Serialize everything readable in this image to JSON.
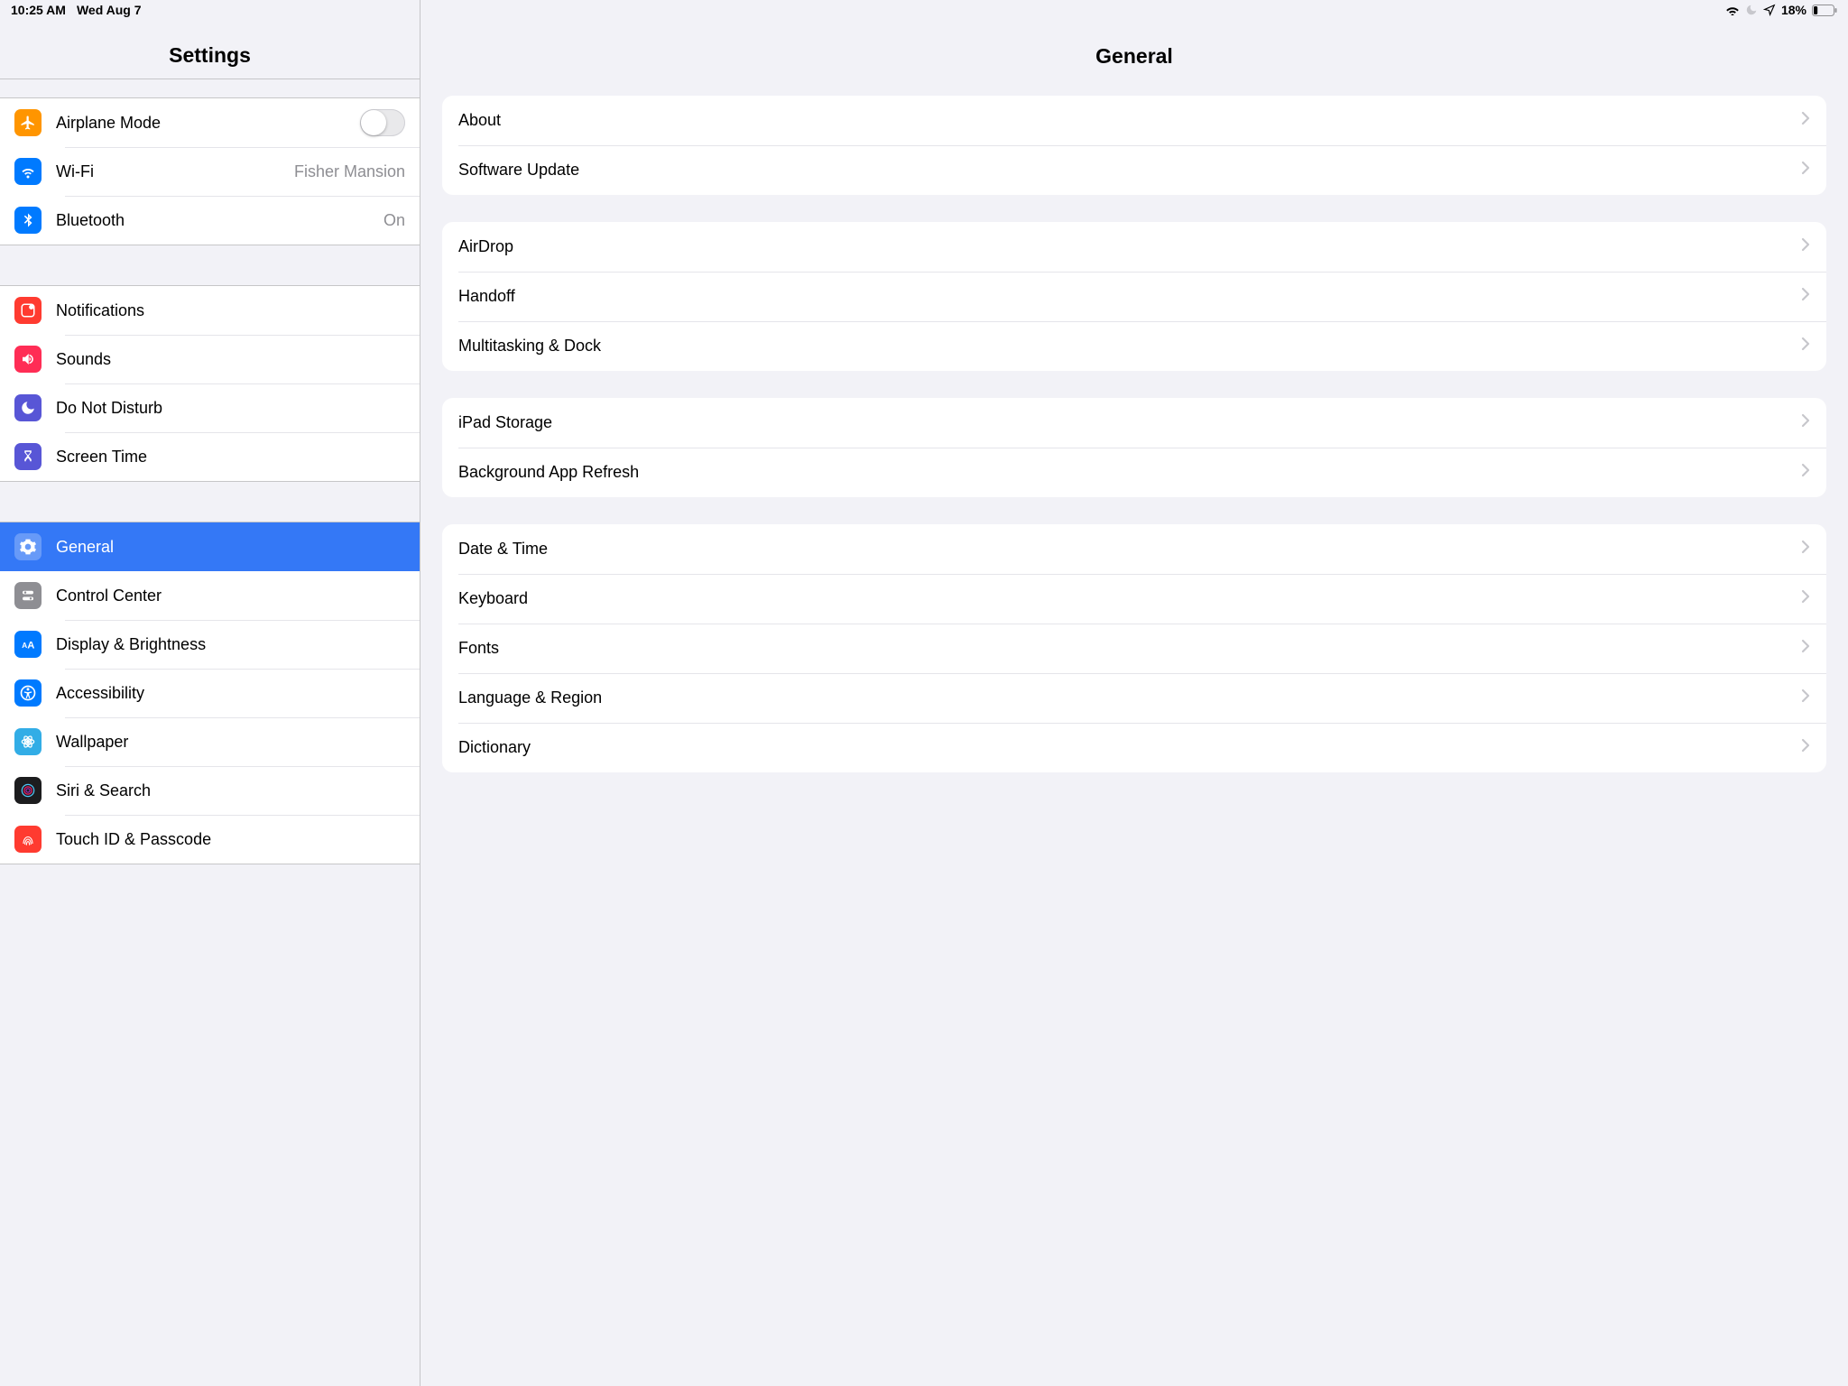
{
  "status": {
    "time": "10:25 AM",
    "date": "Wed Aug 7",
    "battery_pct": "18%"
  },
  "sidebar": {
    "title": "Settings",
    "group1": {
      "airplane": "Airplane Mode",
      "wifi": "Wi-Fi",
      "wifi_value": "Fisher Mansion",
      "bluetooth": "Bluetooth",
      "bluetooth_value": "On"
    },
    "group2": {
      "notifications": "Notifications",
      "sounds": "Sounds",
      "dnd": "Do Not Disturb",
      "screentime": "Screen Time"
    },
    "group3": {
      "general": "General",
      "controlcenter": "Control Center",
      "display": "Display & Brightness",
      "accessibility": "Accessibility",
      "wallpaper": "Wallpaper",
      "siri": "Siri & Search",
      "touchid": "Touch ID & Passcode"
    }
  },
  "detail": {
    "title": "General",
    "g1": {
      "about": "About",
      "swupdate": "Software Update"
    },
    "g2": {
      "airdrop": "AirDrop",
      "handoff": "Handoff",
      "multitask": "Multitasking & Dock"
    },
    "g3": {
      "storage": "iPad Storage",
      "bgrefresh": "Background App Refresh"
    },
    "g4": {
      "datetime": "Date & Time",
      "keyboard": "Keyboard",
      "fonts": "Fonts",
      "langregion": "Language & Region",
      "dictionary": "Dictionary"
    }
  }
}
